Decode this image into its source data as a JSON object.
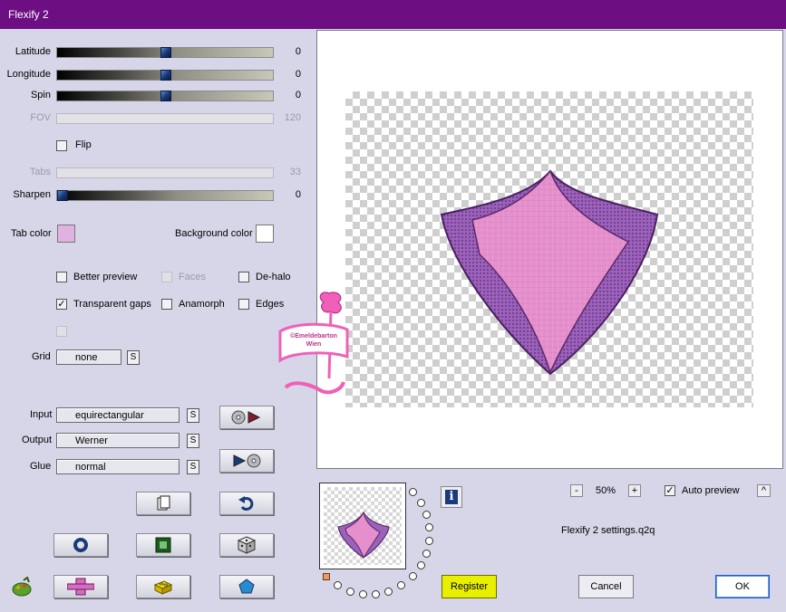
{
  "window": {
    "title": "Flexify 2"
  },
  "sliders": [
    {
      "label": "Latitude",
      "value": "0",
      "position": 0.5,
      "enabled": true
    },
    {
      "label": "Longitude",
      "value": "0",
      "position": 0.5,
      "enabled": true
    },
    {
      "label": "Spin",
      "value": "0",
      "position": 0.5,
      "enabled": true
    },
    {
      "label": "FOV",
      "value": "120",
      "position": 0,
      "enabled": false
    },
    {
      "label": "Tabs",
      "value": "33",
      "position": 0,
      "enabled": false
    },
    {
      "label": "Sharpen",
      "value": "0",
      "position": 0,
      "enabled": true
    }
  ],
  "flip": {
    "label": "Flip",
    "checked": false
  },
  "colors": {
    "tab_label": "Tab color",
    "tab_color": "#dfb2e0",
    "background_label": "Background color",
    "background_color": "#ffffff",
    "title_bar": "#6d0f82"
  },
  "options": {
    "better_preview": {
      "label": "Better preview",
      "checked": false
    },
    "faces": {
      "label": "Faces",
      "checked": false
    },
    "de_halo": {
      "label": "De-halo",
      "checked": false
    },
    "transparent_gaps": {
      "label": "Transparent gaps",
      "checked": true
    },
    "anamorph": {
      "label": "Anamorph",
      "checked": false
    },
    "edges": {
      "label": "Edges",
      "checked": false
    }
  },
  "grid": {
    "label": "Grid",
    "value": "none",
    "s": "S"
  },
  "input": {
    "label": "Input",
    "value": "equirectangular",
    "s": "S"
  },
  "output": {
    "label": "Output",
    "value": "Werner",
    "s": "S"
  },
  "glue": {
    "label": "Glue",
    "value": "normal",
    "s": "S"
  },
  "zoom": {
    "minus": "-",
    "value": "50%",
    "plus": "+"
  },
  "auto_preview": {
    "label": "Auto preview",
    "checked": true,
    "toggle": "^"
  },
  "settings_file": "Flexify 2 settings.q2q",
  "buttons": {
    "register": "Register",
    "cancel": "Cancel",
    "ok": "OK"
  },
  "icons": {
    "info": "i",
    "checkmark": "✓"
  },
  "watermark": "©Emeldebarton Wien"
}
